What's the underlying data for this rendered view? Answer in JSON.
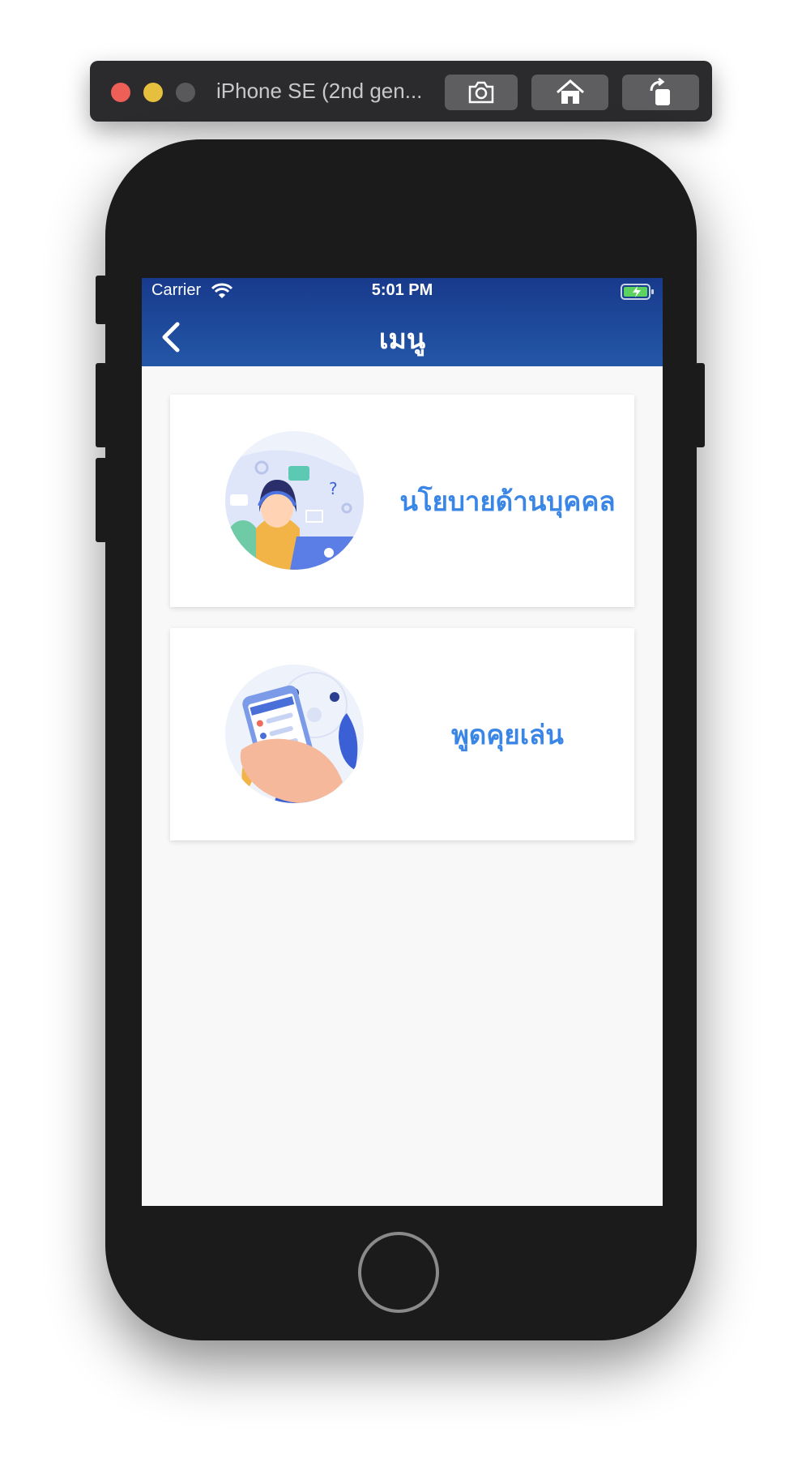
{
  "simulator": {
    "title": "iPhone SE (2nd gen...",
    "buttons": [
      "screenshot",
      "home",
      "rotate"
    ]
  },
  "status_bar": {
    "carrier": "Carrier",
    "time": "5:01 PM"
  },
  "nav": {
    "title": "เมนู"
  },
  "menu": {
    "items": [
      {
        "label": "นโยบายด้านบุคคล",
        "icon": "customer-support-illustration"
      },
      {
        "label": "พูดคุยเล่น",
        "icon": "chat-phone-illustration"
      }
    ]
  },
  "colors": {
    "header_top": "#183a8c",
    "header_bottom": "#2457a8",
    "accent_text": "#3a86e6",
    "screen_bg": "#f8f8f8"
  }
}
